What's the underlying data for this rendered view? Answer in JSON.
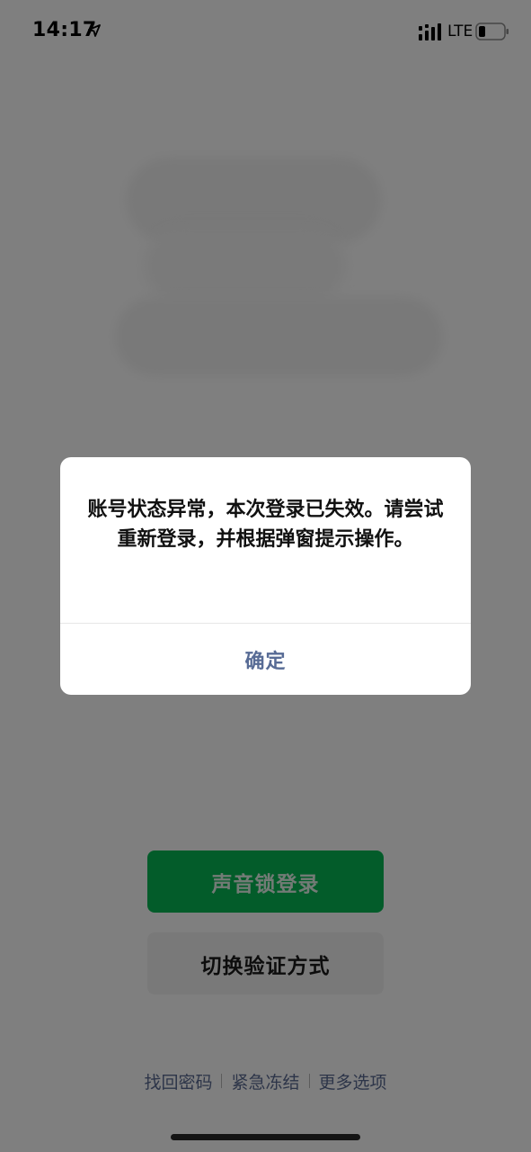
{
  "status_bar": {
    "time": "14:17",
    "network": "LTE",
    "icons": [
      "location-arrow-icon",
      "signal-icon",
      "battery-icon"
    ]
  },
  "login": {
    "primary_button": "声音锁登录",
    "secondary_button": "切换验证方式",
    "links": [
      "找回密码",
      "紧急冻结",
      "更多选项"
    ]
  },
  "dialog": {
    "message": "账号状态异常，本次登录已失效。请尝试重新登录，并根据弹窗提示操作。",
    "confirm_label": "确定"
  },
  "colors": {
    "primary_green": "#07b954",
    "link_blue": "#576b95",
    "overlay": "rgba(0,0,0,0.5)"
  }
}
